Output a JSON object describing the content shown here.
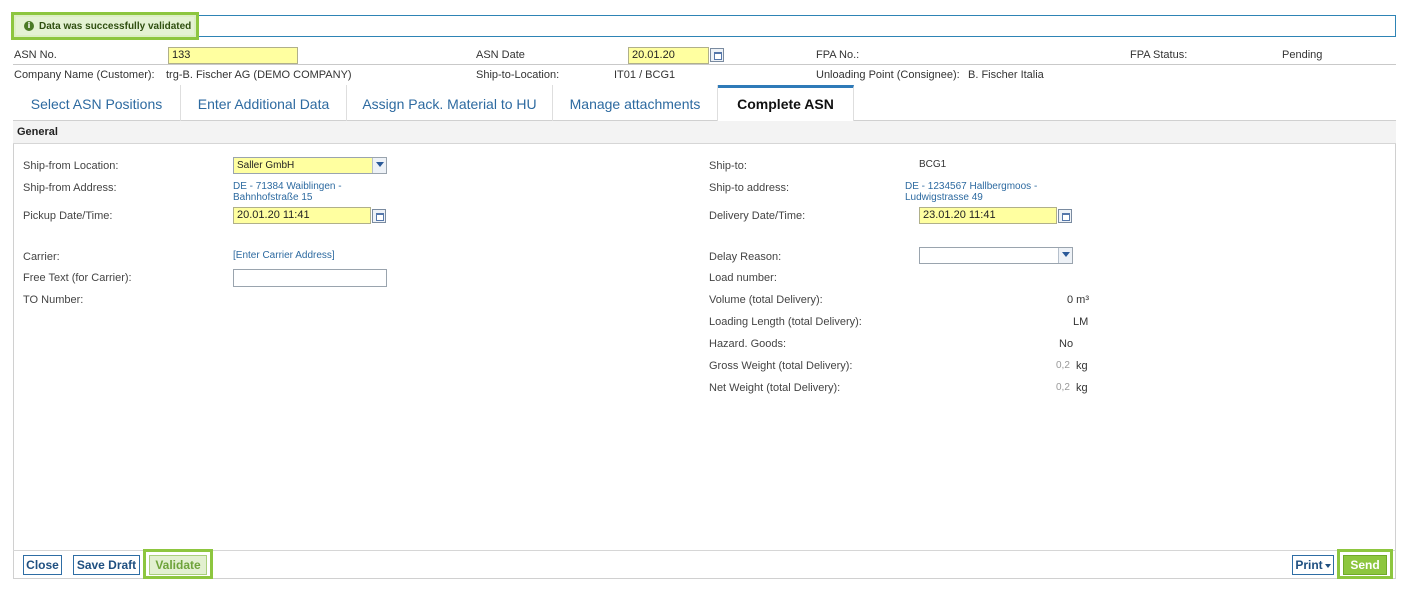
{
  "message": {
    "text": "Data was successfully validated",
    "icon": "info-icon"
  },
  "header": {
    "asn_no_label": "ASN No.",
    "asn_no_value": "133",
    "asn_date_label": "ASN Date",
    "asn_date_value": "20.01.20",
    "fpa_no_label": "FPA No.:",
    "fpa_status_label": "FPA Status:",
    "fpa_status_value": "Pending",
    "company_label": "Company Name (Customer):",
    "company_value": "trg-B. Fischer AG (DEMO COMPANY)",
    "ship_to_location_label": "Ship-to-Location:",
    "ship_to_location_value": "IT01 / BCG1",
    "unloading_label": "Unloading Point (Consignee):",
    "unloading_value": "B. Fischer Italia"
  },
  "tabs": [
    {
      "label": "Select ASN Positions"
    },
    {
      "label": "Enter Additional Data"
    },
    {
      "label": "Assign Pack. Material to HU"
    },
    {
      "label": "Manage attachments"
    },
    {
      "label": "Complete ASN",
      "active": true
    }
  ],
  "section": {
    "title": "General"
  },
  "left": {
    "ship_from_location_label": "Ship-from Location:",
    "ship_from_location_value": "Saller GmbH",
    "ship_from_address_label": "Ship-from Address:",
    "ship_from_address_line1": "DE - 71384 Waiblingen -",
    "ship_from_address_line2": "Bahnhofstraße 15",
    "pickup_label": "Pickup Date/Time:",
    "pickup_value": "20.01.20 11:41",
    "carrier_label": "Carrier:",
    "carrier_link": "[Enter Carrier Address]",
    "free_text_label": "Free Text (for Carrier):",
    "free_text_value": "",
    "to_number_label": "TO Number:"
  },
  "right": {
    "ship_to_label": "Ship-to:",
    "ship_to_value": "BCG1",
    "ship_to_address_label": "Ship-to address:",
    "ship_to_address_line1": "DE - 1234567 Hallbergmoos -",
    "ship_to_address_line2": "Ludwigstrasse 49",
    "delivery_label": "Delivery Date/Time:",
    "delivery_value": "23.01.20 11:41",
    "delay_reason_label": "Delay Reason:",
    "delay_reason_value": "",
    "load_number_label": "Load number:",
    "volume_label": "Volume (total Delivery):",
    "volume_value": "0 m³",
    "loading_length_label": "Loading Length (total Delivery):",
    "loading_length_value": "LM",
    "hazard_label": "Hazard. Goods:",
    "hazard_value": "No",
    "gross_weight_label": "Gross Weight (total Delivery):",
    "gross_weight_value": "0,2",
    "gross_weight_unit": "kg",
    "net_weight_label": "Net Weight (total Delivery):",
    "net_weight_value": "0,2",
    "net_weight_unit": "kg"
  },
  "buttons": {
    "close": "Close",
    "save_draft": "Save Draft",
    "validate": "Validate",
    "print": "Print",
    "send": "Send"
  },
  "colors": {
    "highlight_green": "#8dc63f",
    "input_yellow": "#ffffa0",
    "link_blue": "#2d6aa0"
  }
}
